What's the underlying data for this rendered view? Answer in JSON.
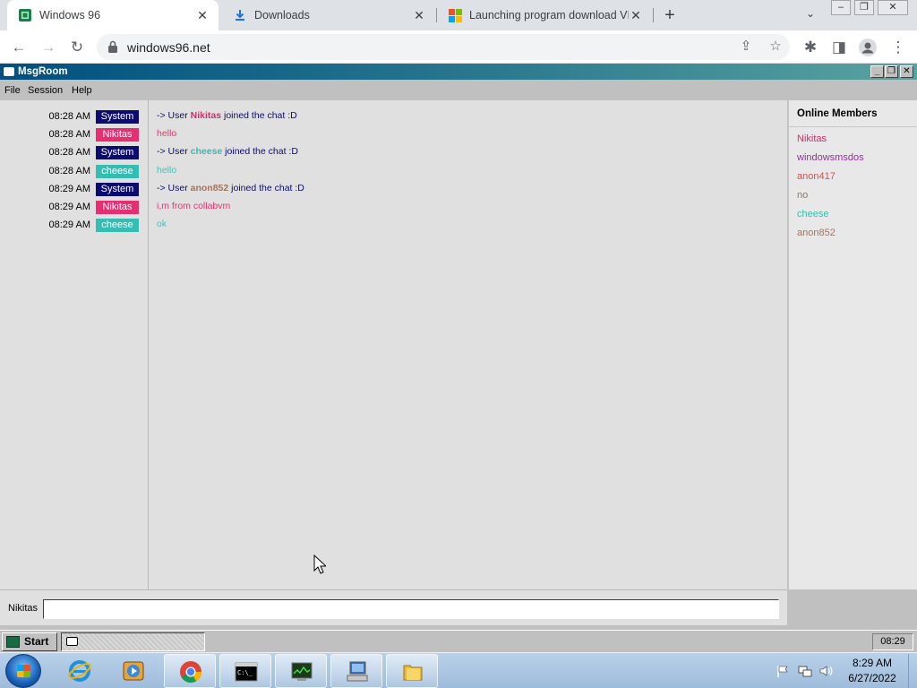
{
  "browser": {
    "tabs": [
      {
        "title": "Windows 96",
        "favicon": "win96-icon",
        "active": true
      },
      {
        "title": "Downloads",
        "favicon": "download-icon",
        "active": false
      },
      {
        "title": "Launching program download VI",
        "favicon": "microsoft-icon",
        "active": false
      }
    ],
    "new_tab_label": "+",
    "url": "windows96.net"
  },
  "msgroom": {
    "window_title": "MsgRoom",
    "menu": [
      "File",
      "Session",
      "Help"
    ],
    "messages": [
      {
        "time": "08:28 AM",
        "user": "System",
        "user_color": "#0b0b72",
        "kind": "join",
        "prefix": "-> User ",
        "name": "Nikitas",
        "name_color": "#d42c6c",
        "suffix": " joined the chat :D"
      },
      {
        "time": "08:28 AM",
        "user": "Nikitas",
        "user_color": "#e52f70",
        "kind": "text",
        "text": "hello",
        "text_color": "#e5356f"
      },
      {
        "time": "08:28 AM",
        "user": "System",
        "user_color": "#0b0b72",
        "kind": "join",
        "prefix": "-> User ",
        "name": "cheese",
        "name_color": "#3bb8b0",
        "suffix": " joined the chat :D"
      },
      {
        "time": "08:28 AM",
        "user": "cheese",
        "user_color": "#36bdb3",
        "kind": "text",
        "text": "hello",
        "text_color": "#46c0b8"
      },
      {
        "time": "08:29 AM",
        "user": "System",
        "user_color": "#0b0b72",
        "kind": "join",
        "prefix": "-> User ",
        "name": "anon852",
        "name_color": "#a27460",
        "suffix": " joined the chat :D"
      },
      {
        "time": "08:29 AM",
        "user": "Nikitas",
        "user_color": "#e52f70",
        "kind": "text",
        "text": "i,m from collabvm",
        "text_color": "#e5356f"
      },
      {
        "time": "08:29 AM",
        "user": "cheese",
        "user_color": "#36bdb3",
        "kind": "text",
        "text": "ok",
        "text_color": "#46c0b8"
      }
    ],
    "members_title": "Online Members",
    "members": [
      {
        "name": "Nikitas",
        "color": "#d42c6c"
      },
      {
        "name": "windowsmsdos",
        "color": "#9b2aa8"
      },
      {
        "name": "anon417",
        "color": "#e04d4d"
      },
      {
        "name": "no",
        "color": "#8a7a6a"
      },
      {
        "name": "cheese",
        "color": "#3bb8b0"
      },
      {
        "name": "anon852",
        "color": "#a27460"
      }
    ],
    "nickname": "Nikitas",
    "input_value": "",
    "input_placeholder": ""
  },
  "w96_taskbar": {
    "start_label": "Start",
    "clock": "08:29"
  },
  "w7_taskbar": {
    "time": "8:29 AM",
    "date": "6/27/2022"
  }
}
